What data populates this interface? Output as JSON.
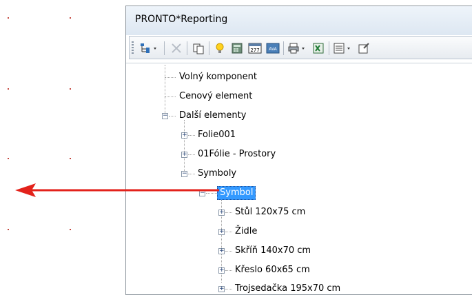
{
  "window": {
    "title": "PRONTO*Reporting"
  },
  "toolbar": {
    "buttons": [
      {
        "name": "tree-view-dropdown-icon",
        "glyph": "🗂"
      },
      {
        "name": "delete-icon",
        "glyph": "✕"
      },
      {
        "name": "copy-icon",
        "glyph": "📋"
      },
      {
        "name": "lightbulb-icon",
        "glyph": "💡"
      },
      {
        "name": "calculator-icon",
        "glyph": "🧮"
      },
      {
        "name": "counter-277-icon",
        "glyph": "277"
      },
      {
        "name": "ava-icon",
        "glyph": "AVA"
      },
      {
        "name": "print-dropdown-icon",
        "glyph": "🖨"
      },
      {
        "name": "excel-export-icon",
        "glyph": "X"
      },
      {
        "name": "list-dropdown-icon",
        "glyph": "▤"
      },
      {
        "name": "properties-icon",
        "glyph": "🛠"
      }
    ]
  },
  "tree": {
    "items": [
      {
        "label": "Volný komponent"
      },
      {
        "label": "Cenový element"
      },
      {
        "label": "Další elementy"
      },
      {
        "label": "Folie001"
      },
      {
        "label": "01Fólie - Prostory"
      },
      {
        "label": "Symboly"
      },
      {
        "label": "Symbol"
      },
      {
        "label": "Stůl 120x75 cm"
      },
      {
        "label": "Židle"
      },
      {
        "label": "Skříň 140x70 cm"
      },
      {
        "label": "Křeslo 60x65 cm"
      },
      {
        "label": "Trojsedačka 195x70 cm"
      }
    ]
  },
  "colors": {
    "selection": "#3399ff",
    "arrow": "#e3221b"
  }
}
